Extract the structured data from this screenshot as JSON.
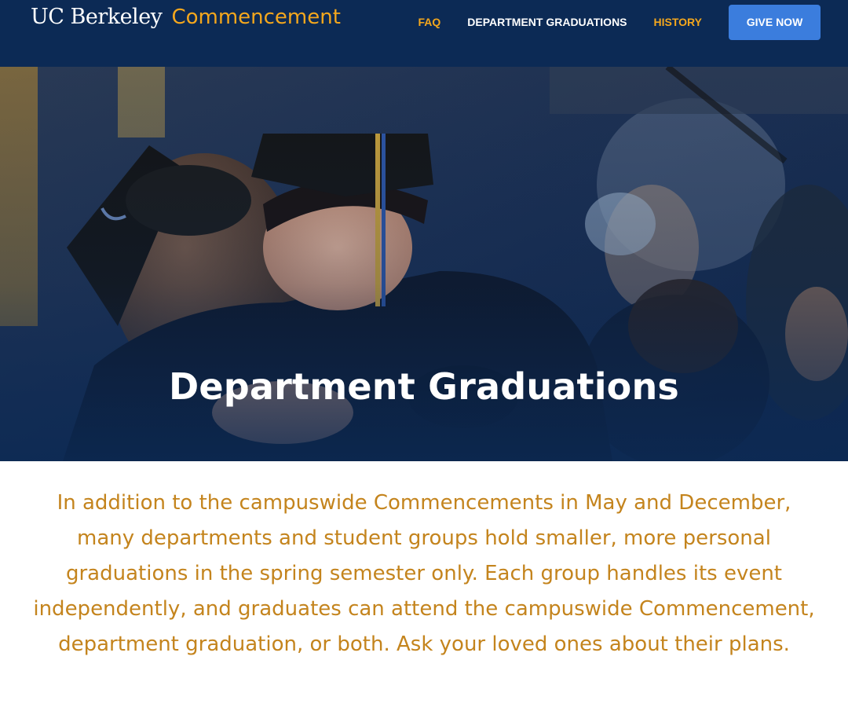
{
  "header": {
    "brand_uc": "UC Berkeley",
    "brand_commencement": "Commencement",
    "nav": {
      "faq": "FAQ",
      "department_graduations": "DEPARTMENT GRADUATIONS",
      "history": "HISTORY",
      "give_now": "GIVE NOW"
    }
  },
  "hero": {
    "title": "Department Graduations"
  },
  "intro": {
    "text": "In addition to the campuswide Commencements in May and December, many departments and student groups hold smaller, more personal graduations in the spring semester only. Each group handles its event independently, and graduates can attend the campuswide Commencement, department graduation, or both. Ask your loved ones about their plans."
  },
  "colors": {
    "header_bg": "#0c2a55",
    "gold": "#f4a71d",
    "body_text": "#c4841d",
    "button_blue": "#3b7ddd"
  }
}
